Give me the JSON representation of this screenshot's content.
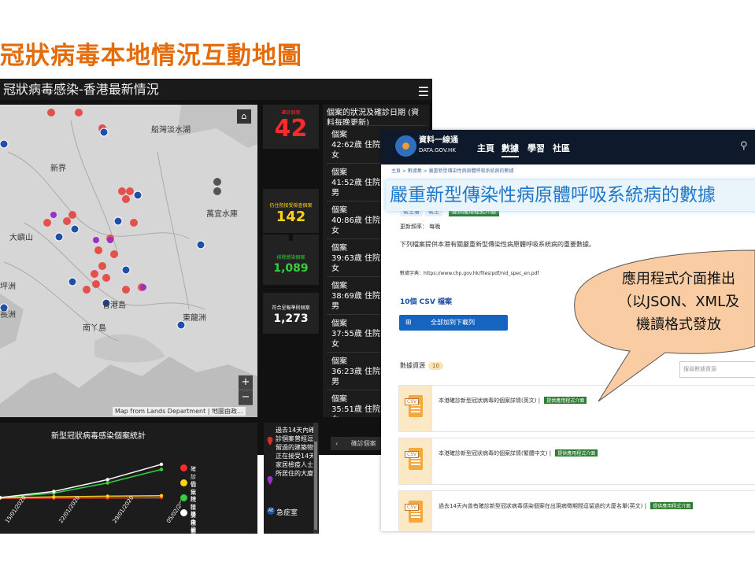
{
  "slide_title": "冠狀病毒本地情況互動地圖",
  "dashboard": {
    "title": "冠狀病毒感染-香港最新情況",
    "menu_icon": "hamburger-icon",
    "map_labels": [
      "船灣淡水湖",
      "新界",
      "萬宜水庫",
      "大嶼山",
      "坪洲",
      "香港島",
      "東龍洲",
      "南丫島",
      "長洲"
    ],
    "map_credit": "Map from Lands Department | 地圖由政...",
    "stats": {
      "confirmed_label": "確診個案",
      "confirmed_value": "42",
      "hospital_label": "仍住院接受檢查個案",
      "hospital_value": "142",
      "excluded_label": "排除感染個案",
      "excluded_value": "1,089",
      "reported_label": "符合呈報準則個案",
      "reported_value": "1,273",
      "colors": {
        "confirmed": "#ff2a2a",
        "hospital": "#ffd11a",
        "excluded": "#33d13a",
        "reported": "#ffffff"
      }
    },
    "cases_header": "個案的狀況及確診日期 (資料每晚更新)",
    "cases": [
      {
        "id": "個案42",
        "detail": ":62歲女",
        "status": "住院"
      },
      {
        "id": "個案41",
        "detail": ":52歲男",
        "status": "住院"
      },
      {
        "id": "個案40",
        "detail": ":86歲女",
        "status": "住院"
      },
      {
        "id": "個案39",
        "detail": ":63歲女",
        "status": "住院"
      },
      {
        "id": "個案38",
        "detail": ":69歲男",
        "status": "住院"
      },
      {
        "id": "個案37",
        "detail": ":55歲女",
        "status": "住院"
      },
      {
        "id": "個案36",
        "detail": ":23歲男",
        "status": "住院"
      },
      {
        "id": "個案35",
        "detail": ":51歲女",
        "status": "住院"
      }
    ],
    "footer_tab": "確診個案",
    "chart_title": "新型冠狀病毒感染個案統計",
    "legend": [
      {
        "label": "確診個案",
        "color": "#ff2a2a"
      },
      {
        "label": "仍住院接受檢查個案",
        "color": "#ffd11a"
      },
      {
        "label": "排除感染個案",
        "color": "#33d13a"
      },
      {
        "label": "符合呈報準則個案",
        "color": "#ffffff"
      }
    ],
    "side_text": "過去14天內確診個案曾經逗留過的建築物 正在接受14天家居檢疫人士所居住的大廈",
    "side_legend_ae": "急症室"
  },
  "chart_data": {
    "type": "line",
    "title": "新型冠狀病毒感染個案統計",
    "x": [
      "15/01/2020",
      "22/01/2020",
      "29/01/2020",
      "05/02/2020"
    ],
    "series": [
      {
        "name": "確診個案",
        "color": "#ff2a2a",
        "values": [
          0,
          2,
          10,
          21
        ]
      },
      {
        "name": "仍住院接受檢查個案",
        "color": "#ffd11a",
        "values": [
          10,
          40,
          60,
          75
        ]
      },
      {
        "name": "排除感染個案",
        "color": "#33d13a",
        "values": [
          15,
          150,
          450,
          850
        ]
      },
      {
        "name": "符合呈報準則個案",
        "color": "#ffffff",
        "values": [
          20,
          200,
          550,
          1000
        ]
      }
    ],
    "ylim": [
      0,
      1300
    ]
  },
  "portal": {
    "brand_main": "資料一線通",
    "brand_sub": "DATA.GOV.HK",
    "nav": [
      "主頁",
      "數據",
      "學習",
      "社區"
    ],
    "nav_active": "數據",
    "breadcrumb": "主頁 > 數據集 > 嚴重新型傳染性病原體呼吸系統病的數據",
    "title": "嚴重新型傳染性病原體呼吸系統病的數據",
    "tags": [
      "衛生署",
      "衛生",
      "提供應用程式介面"
    ],
    "update_freq": "更新頻率： 每晚",
    "description": "下列檔案提供本港有關嚴重新型傳染性病原體呼吸系統病的重要數據。",
    "data_dictionary": "數據字典：https://www.chp.gov.hk/files/pdf/nid_spec_en.pdf",
    "csv_count": "10個 CSV 檔案",
    "add_all_button": "全部加到下載列",
    "resources_label": "數據資源",
    "resources_count": "10",
    "search_placeholder": "搜尋數據資源",
    "resources": [
      {
        "title": "本港確診新型冠狀病毒的個案詳情(英文)",
        "badge": "提供應用程式介面"
      },
      {
        "title": "本港確診新型冠狀病毒的個案詳情(繁體中文)",
        "badge": "提供應用程式介面"
      },
      {
        "title": "過去14天內曾有確診新型冠狀病毒感染個案在出現病徵期間逗留過的大廈名單(英文)",
        "badge": "提供應用程式介面"
      }
    ]
  },
  "callout": {
    "line1": "應用程式介面推出",
    "line2": "（以JSON、XML及",
    "line3": "機讀格式發放"
  }
}
